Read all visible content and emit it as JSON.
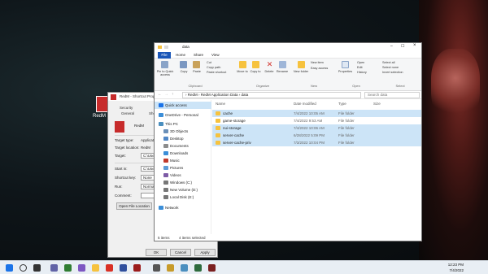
{
  "explorer": {
    "title": "data",
    "tabs": {
      "file": "File",
      "home": "Home",
      "share": "Share",
      "view": "View"
    },
    "ribbon": {
      "clipboard": {
        "pin": "Pin to Quick access",
        "copy": "Copy",
        "paste": "Paste",
        "cut": "Cut",
        "copy_path": "Copy path",
        "paste_shortcut": "Paste shortcut",
        "group": "Clipboard"
      },
      "organize": {
        "move_to": "Move to",
        "copy_to": "Copy to",
        "delete": "Delete",
        "rename": "Rename",
        "group": "Organize"
      },
      "new": {
        "new_folder": "New folder",
        "new_item": "New item",
        "easy_access": "Easy access",
        "group": "New"
      },
      "open": {
        "properties": "Properties",
        "open": "Open",
        "edit": "Edit",
        "history": "History",
        "group": "Open"
      },
      "select": {
        "select_all": "Select all",
        "select_none": "Select none",
        "invert": "Invert selection",
        "group": "Select"
      }
    },
    "address": "› RedM › RedM Application Data › data",
    "search_placeholder": "Search data",
    "nav": [
      "Quick access",
      "OneDrive - Personal",
      "This PC",
      "3D Objects",
      "Desktop",
      "Documents",
      "Downloads",
      "Music",
      "Pictures",
      "Videos",
      "Windows (C:)",
      "New Volume (D:)",
      "Local Disk (E:)",
      "Network"
    ],
    "columns": {
      "name": "Name",
      "date": "Date modified",
      "type": "Type",
      "size": "Size"
    },
    "files": [
      {
        "name": "cache",
        "date": "7/4/2022 10:05 AM",
        "type": "File folder",
        "selected": true
      },
      {
        "name": "game-storage",
        "date": "7/4/2022 9:53 AM",
        "type": "File folder",
        "selected": false
      },
      {
        "name": "nui-storage",
        "date": "7/4/2022 10:06 AM",
        "type": "File folder",
        "selected": true
      },
      {
        "name": "server-cache",
        "date": "6/28/2022 5:09 PM",
        "type": "File folder",
        "selected": true
      },
      {
        "name": "server-cache-priv",
        "date": "7/3/2022 10:04 PM",
        "type": "File folder",
        "selected": true
      }
    ],
    "status": {
      "items": "5 items",
      "selected": "4 items selected"
    }
  },
  "properties": {
    "title": "RedM - Shortcut Properties",
    "tabs": {
      "security": "Security",
      "details": "Details",
      "general": "General",
      "shortcut": "Shortcut"
    },
    "name": "RedM",
    "target_type_label": "Target type:",
    "target_type": "Application",
    "target_location_label": "Target location:",
    "target_location": "RedM",
    "target_label": "Target:",
    "target": "C:\\Users\\...",
    "start_in_label": "Start in:",
    "start_in": "C:\\Users\\...",
    "shortcut_key_label": "Shortcut key:",
    "shortcut_key": "None",
    "run_label": "Run:",
    "run": "Normal window",
    "comment_label": "Comment:",
    "open_file_location": "Open File Location",
    "ok": "OK",
    "cancel": "Cancel",
    "apply": "Apply"
  },
  "desktop": {
    "icon_label": "RedM Shortcut"
  },
  "taskbar": {
    "time": "12:23 PM",
    "date": "7/4/2022"
  }
}
